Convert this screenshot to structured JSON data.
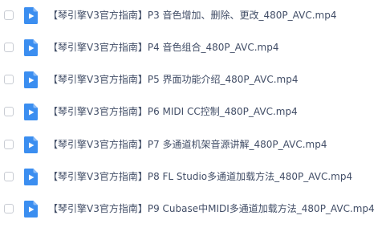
{
  "files": [
    {
      "name": "【琴引擎V3官方指南】P3 音色增加、删除、更改_480P_AVC.mp4",
      "icon": "video-file-icon"
    },
    {
      "name": "【琴引擎V3官方指南】P4 音色组合_480P_AVC.mp4",
      "icon": "video-file-icon"
    },
    {
      "name": "【琴引擎V3官方指南】P5 界面功能介绍_480P_AVC.mp4",
      "icon": "video-file-icon"
    },
    {
      "name": "【琴引擎V3官方指南】P6 MIDI CC控制_480P_AVC.mp4",
      "icon": "video-file-icon"
    },
    {
      "name": "【琴引擎V3官方指南】P7 多通道机架音源讲解_480P_AVC.mp4",
      "icon": "video-file-icon"
    },
    {
      "name": "【琴引擎V3官方指南】P8 FL Studio多通道加载方法_480P_AVC.mp4",
      "icon": "video-file-icon"
    },
    {
      "name": "【琴引擎V3官方指南】P9 Cubase中MIDI多通道加载方法_480P_AVC.mp4",
      "icon": "video-file-icon"
    }
  ],
  "colors": {
    "icon": "#3b8ef0",
    "text": "#424e67",
    "checkbox_border": "#c8ccd3"
  }
}
